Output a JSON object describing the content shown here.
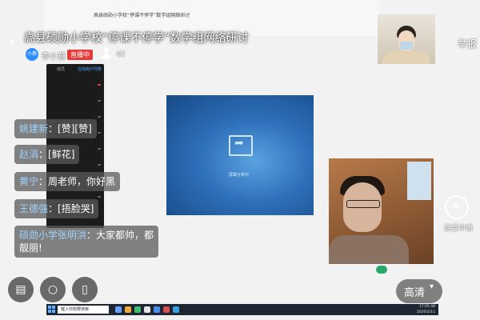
{
  "header": {
    "back_label": "‹",
    "title": "高县硕勋小学校“停课不停学”数学组网络研讨",
    "report_label": "举报"
  },
  "host": {
    "avatar_text": "小燕",
    "name": "李小燕",
    "live_badge": "直播中",
    "viewer_count": "62"
  },
  "shared_screen": {
    "doc_title": "高县硕勋小学校“停课不停学”数学组网络研讨",
    "participant_tabs": [
      "成员",
      "在线用户列表"
    ],
    "slide_caption": "屏幕分享中"
  },
  "chat": [
    {
      "name": "姚建新",
      "text": "[赞][赞]"
    },
    {
      "name": "赵涓",
      "text": "[鲜花]"
    },
    {
      "name": "黄宁",
      "text": "周老师，你好黑"
    },
    {
      "name": "王德强",
      "text": "[捂脸哭]"
    },
    {
      "name": "硕勋小学张明洪",
      "text": "大家都帅，都",
      "text2": "靓丽!"
    }
  ],
  "right_panel": {
    "connect_label": "连麦申请"
  },
  "bottom": {
    "quality_label": "高清",
    "quality_caret": "▾"
  },
  "taskbar": {
    "search_placeholder": "键入你想要搜索",
    "time": "17:05:48",
    "date": "2020/2/11"
  },
  "colors": {
    "live_badge": "#e83a3a",
    "chat_name": "#9fd3ff",
    "accent": "#2a8cff"
  }
}
